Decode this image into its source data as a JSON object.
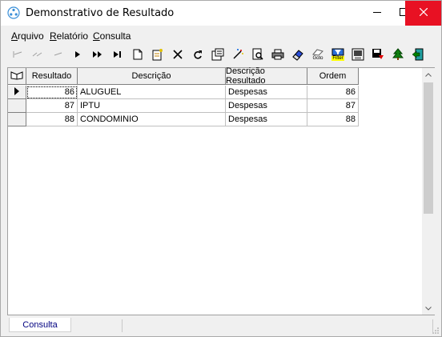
{
  "window": {
    "title": "Demonstrativo de Resultado",
    "title_icon": "app-icon",
    "controls": [
      "minimize-icon",
      "maximize-icon",
      "close-icon"
    ]
  },
  "menu": {
    "items": [
      {
        "label": "Arquivo",
        "accel_index": 0
      },
      {
        "label": "Relatório",
        "accel_index": 0
      },
      {
        "label": "Consulta",
        "accel_index": 0
      }
    ]
  },
  "toolbar": {
    "buttons": [
      {
        "name": "first-record-icon"
      },
      {
        "name": "prior-page-icon"
      },
      {
        "name": "prior-record-icon"
      },
      {
        "name": "next-record-icon"
      },
      {
        "name": "next-page-icon"
      },
      {
        "name": "last-record-icon"
      },
      {
        "name": "new-record-icon"
      },
      {
        "name": "edit-record-icon"
      },
      {
        "name": "delete-record-icon"
      },
      {
        "name": "refresh-icon"
      },
      {
        "name": "properties-icon"
      },
      {
        "name": "magic-wand-icon"
      },
      {
        "name": "preview-icon"
      },
      {
        "name": "print-icon"
      },
      {
        "name": "eraser-icon"
      },
      {
        "name": "goto-icon",
        "caption": "Goto"
      },
      {
        "name": "filter-icon",
        "caption": "Filter"
      },
      {
        "name": "export-icon"
      },
      {
        "name": "save-export-icon"
      },
      {
        "name": "tree-icon"
      },
      {
        "name": "exit-icon"
      }
    ]
  },
  "grid": {
    "columns": [
      "Resultado",
      "Descrição",
      "Descrição Resultado",
      "Ordem"
    ],
    "rows": [
      {
        "resultado": "86",
        "descricao": "ALUGUEL",
        "descricao_resultado": "Despesas",
        "ordem": "86",
        "current": true
      },
      {
        "resultado": "87",
        "descricao": "IPTU",
        "descricao_resultado": "Despesas",
        "ordem": "87",
        "current": false
      },
      {
        "resultado": "88",
        "descricao": "CONDOMINIO",
        "descricao_resultado": "Despesas",
        "ordem": "88",
        "current": false
      }
    ]
  },
  "status": {
    "tab_label": "Consulta"
  },
  "colors": {
    "close_button": "#e81123",
    "status_text": "#000080",
    "grid_header": "#f0f0f0"
  }
}
